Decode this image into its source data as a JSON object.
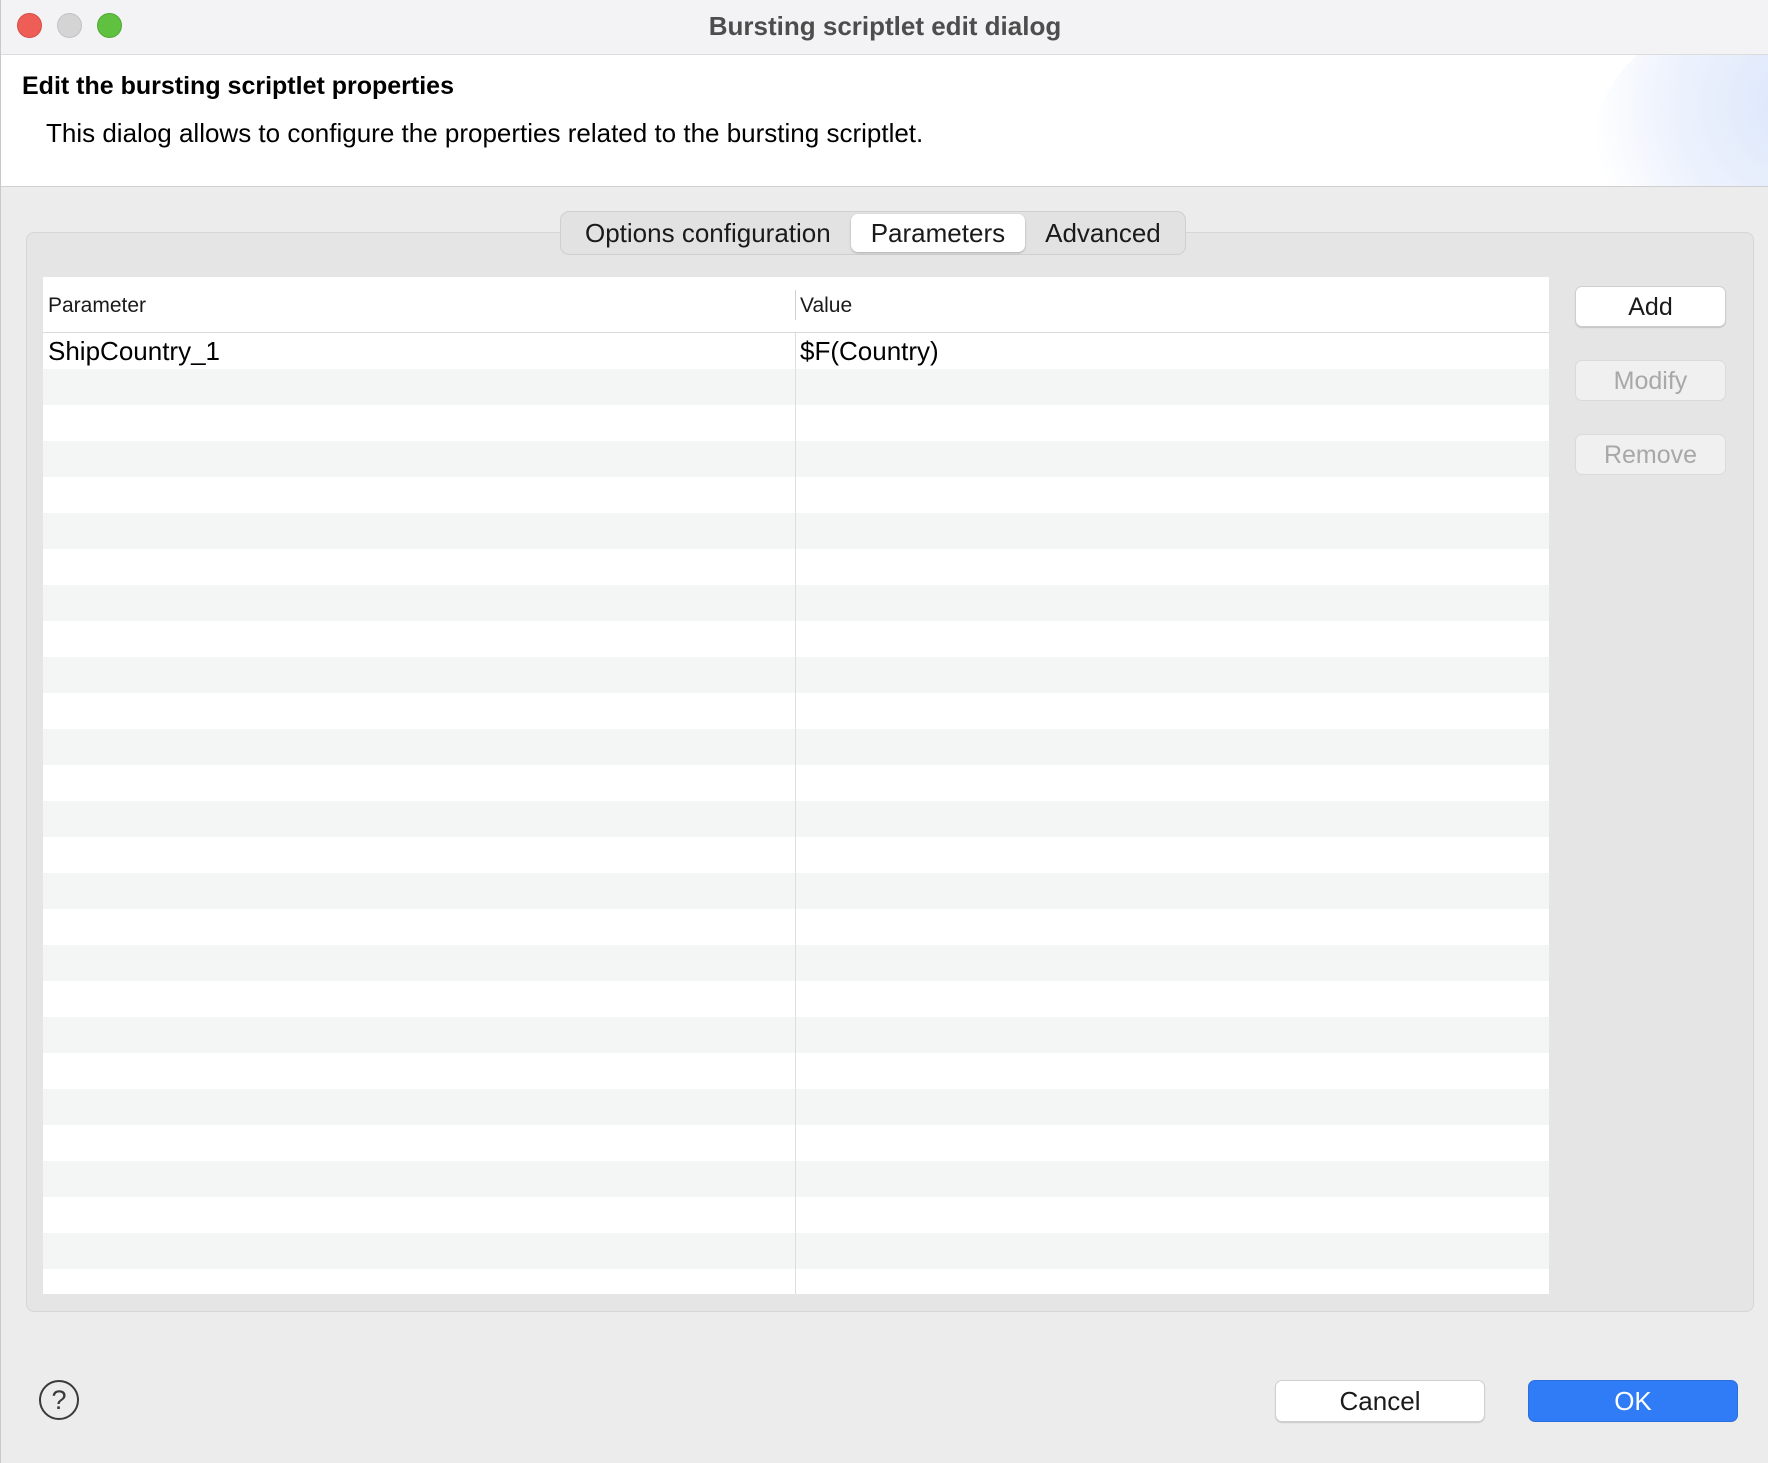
{
  "window": {
    "title": "Bursting scriptlet edit dialog"
  },
  "banner": {
    "title": "Edit the bursting scriptlet properties",
    "description": "This dialog allows to configure the properties related to the bursting scriptlet."
  },
  "tabs": [
    {
      "label": "Options configuration",
      "active": false
    },
    {
      "label": "Parameters",
      "active": true
    },
    {
      "label": "Advanced",
      "active": false
    }
  ],
  "table": {
    "columns": [
      "Parameter",
      "Value"
    ],
    "rows": [
      {
        "parameter": "ShipCountry_1",
        "value": "$F(Country)"
      }
    ]
  },
  "side_buttons": {
    "add": "Add",
    "modify": "Modify",
    "remove": "Remove"
  },
  "footer": {
    "help_glyph": "?",
    "cancel": "Cancel",
    "ok": "OK"
  },
  "colors": {
    "accent": "#2f7cf6",
    "close": "#ee5e57",
    "minimize": "#d4d4d4",
    "maximize": "#5fc13f"
  }
}
